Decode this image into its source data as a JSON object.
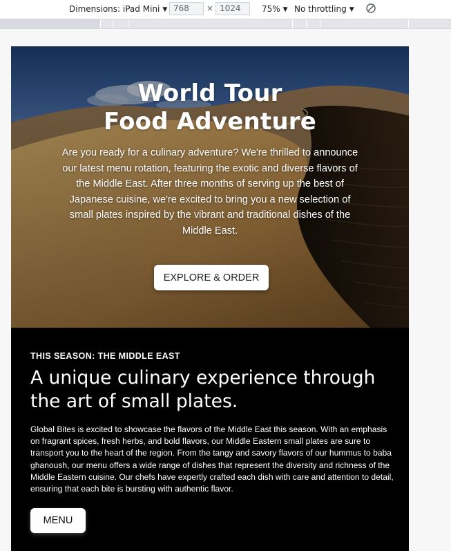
{
  "devtools": {
    "dimensions_label": "Dimensions: iPad Mini",
    "width_value": "768",
    "times": "×",
    "height_value": "1024",
    "zoom": "75%",
    "throttling": "No throttling"
  },
  "hero": {
    "title_line1": "World Tour",
    "title_line2": "Food Adventure",
    "intro": "Are you ready for a culinary adventure? We're thrilled to announce our latest menu rotation, featuring the exotic and diverse flavors of the Middle East. After three months of serving up the best of Japanese cuisine, we're excited to bring you a new selection of small plates inspired by the vibrant and traditional dishes of the Middle East.",
    "cta_label": "EXPLORE & ORDER"
  },
  "season": {
    "eyebrow": "THIS SEASON: THE MIDDLE EAST",
    "headline": "A unique culinary experience through the art of small plates.",
    "body": "Global Bites is excited to showcase the flavors of the Middle East this season. With an emphasis on fragrant spices, fresh herbs, and bold flavors, our Middle Eastern small plates are sure to transport you to the heart of the region. From the tangy and savory flavors of our hummus to baba ghanoush, our menu offers a wide range of dishes that represent the diversity and richness of the Middle Eastern cuisine. Our chefs have expertly crafted each dish with care and attention to detail, ensuring that each bite is bursting with authentic flavor.",
    "menu_label": "MENU"
  }
}
